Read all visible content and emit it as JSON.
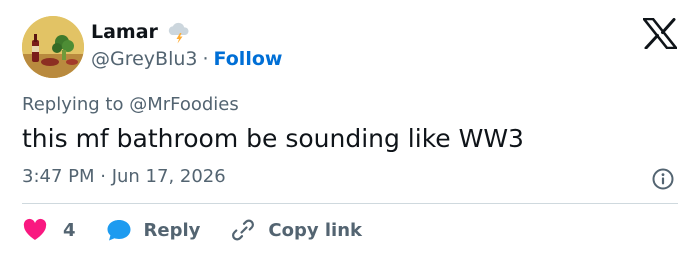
{
  "author": {
    "display_name": "Lamar",
    "handle": "@GreyBlu3",
    "separator": "·",
    "follow_label": "Follow",
    "status_icon": "storm-cloud-icon",
    "avatar": "profile-avatar"
  },
  "brand": {
    "logo": "x-logo-icon"
  },
  "tweet": {
    "replying_to": "Replying to @MrFoodies",
    "text": "this mf bathroom be sounding like WW3",
    "timestamp": "3:47 PM · Jun 17, 2026"
  },
  "actions": {
    "like_count": "4",
    "reply_label": "Reply",
    "copy_link_label": "Copy link"
  },
  "colors": {
    "text_primary": "#0f1419",
    "text_secondary": "#536471",
    "link": "#006fd6",
    "like": "#f91880",
    "reply_bubble": "#1d9bf0",
    "divider": "#cfd9de"
  }
}
